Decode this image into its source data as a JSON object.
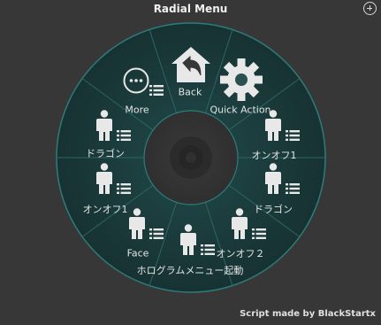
{
  "title": "Radial Menu",
  "footer": "Script made by BlackStartx",
  "colors": {
    "background": "#373737",
    "ring": "#1b3a3a",
    "ring_edge": "#2e7b7b"
  },
  "menu": {
    "back_label": "Back",
    "quick_action_label": "Quick Action",
    "more_label": "More",
    "items": [
      {
        "label": "オンオフ1"
      },
      {
        "label": "ドラゴン"
      },
      {
        "label": "オンオフ２"
      },
      {
        "label": "ホログラムメニュー起動"
      },
      {
        "label": "Face"
      },
      {
        "label": "オンオフ1"
      },
      {
        "label": "ドラゴン"
      }
    ]
  }
}
